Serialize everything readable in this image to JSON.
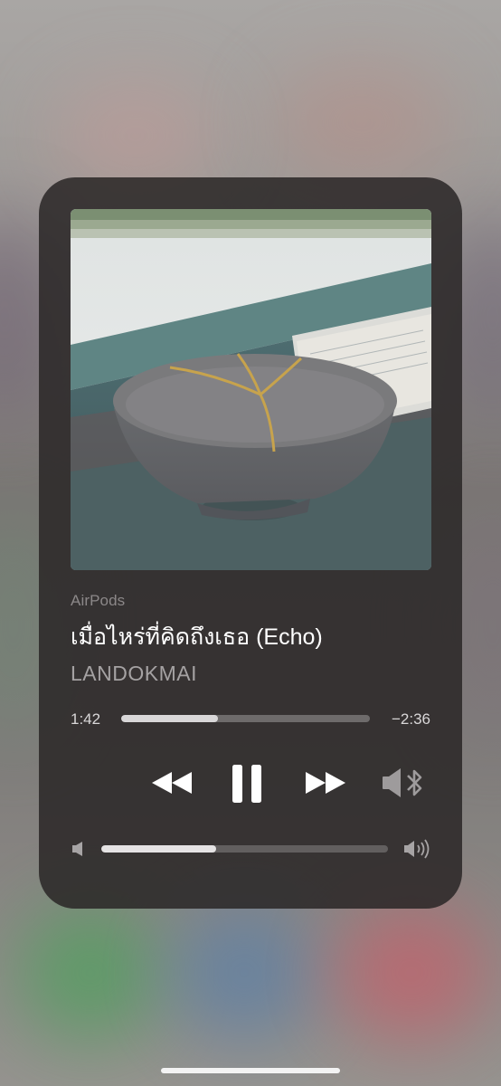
{
  "now_playing": {
    "route": "AirPods",
    "title": "เมื่อไหร่ที่คิดถึงเธอ (Echo)",
    "artist": "LANDOKMAI",
    "elapsed": "1:42",
    "remaining": "−2:36",
    "progress_fraction": 0.39,
    "volume_fraction": 0.4
  },
  "controls": {
    "rewind_icon": "rewind-icon",
    "pause_icon": "pause-icon",
    "fast_forward_icon": "fast-forward-icon",
    "output_icon": "bluetooth-speaker-icon",
    "volume_low_icon": "speaker-low-icon",
    "volume_high_icon": "speaker-high-icon"
  },
  "colors": {
    "card_background": "#2a2627",
    "progress_fill": "#d9d7d8",
    "track": "#6a6667"
  }
}
